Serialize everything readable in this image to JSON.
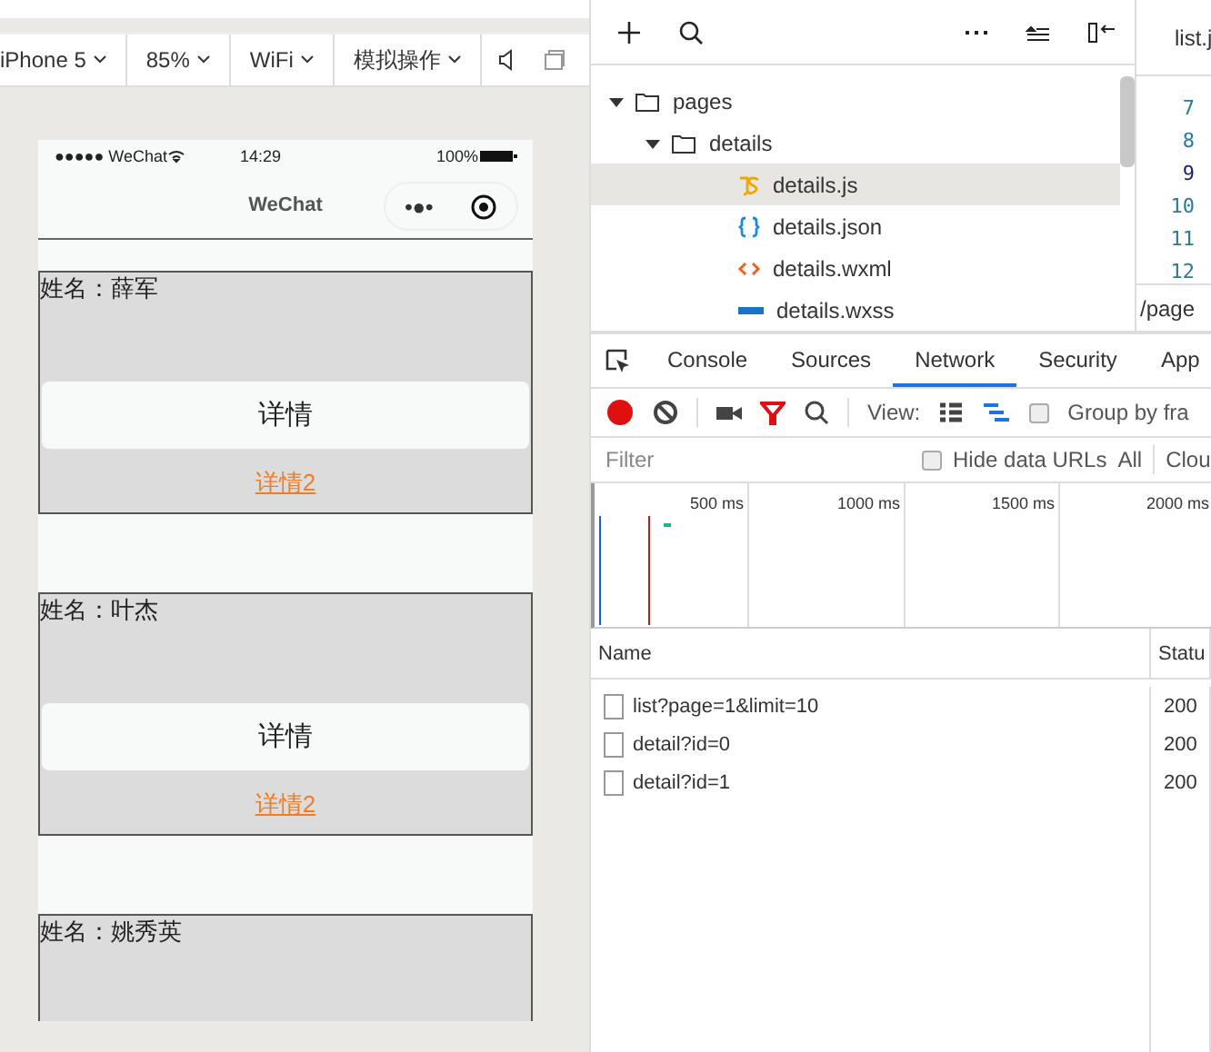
{
  "device_toolbar": [
    {
      "label": "iPhone 5"
    },
    {
      "label": "85%"
    },
    {
      "label": "WiFi"
    },
    {
      "label": "模拟操作"
    }
  ],
  "phone": {
    "status_left": "●●●●● WeChat",
    "time": "14:29",
    "battery": "100%",
    "nav_title": "WeChat",
    "capsule_dots": "•●•",
    "cards": [
      {
        "name": "姓名：薛军",
        "button": "详情",
        "link": "详情2"
      },
      {
        "name": "姓名：叶杰",
        "button": "详情",
        "link": "详情2"
      },
      {
        "name": "姓名：姚秀英"
      }
    ]
  },
  "file_tree": [
    {
      "label": "pages",
      "kind": "folder",
      "expanded": true,
      "selected": false,
      "children": [
        {
          "label": "details",
          "kind": "folder",
          "expanded": true,
          "selected": false,
          "children": [
            {
              "label": "details.js",
              "kind": "js",
              "selected": true
            },
            {
              "label": "details.json",
              "kind": "json",
              "selected": false
            },
            {
              "label": "details.wxml",
              "kind": "wxml",
              "selected": false
            },
            {
              "label": "details.wxss",
              "kind": "wxss",
              "selected": false
            }
          ]
        }
      ]
    }
  ],
  "editor": {
    "tab": "list.j",
    "line_numbers": [
      "7",
      "8",
      "9",
      "10",
      "11",
      "12"
    ],
    "path": "/page"
  },
  "devtools": {
    "tabs": [
      {
        "label": "Console",
        "selected": false
      },
      {
        "label": "Sources",
        "selected": false
      },
      {
        "label": "Network",
        "selected": true
      },
      {
        "label": "Security",
        "selected": false
      },
      {
        "label": "App",
        "selected": false
      }
    ],
    "view_label": "View:",
    "group_label": "Group by fra",
    "group_checked": false,
    "filter_placeholder": "Filter",
    "hide_data_urls": "Hide data URLs",
    "hide_checked": false,
    "all": "All",
    "clou": "Clou",
    "timeline_ticks": [
      "500 ms",
      "1000 ms",
      "1500 ms",
      "2000 ms"
    ],
    "columns": [
      "Name",
      "Statu"
    ],
    "rows": [
      {
        "name": "list?page=1&limit=10",
        "status": "200"
      },
      {
        "name": "detail?id=0",
        "status": "200"
      },
      {
        "name": "detail?id=1",
        "status": "200"
      }
    ]
  }
}
